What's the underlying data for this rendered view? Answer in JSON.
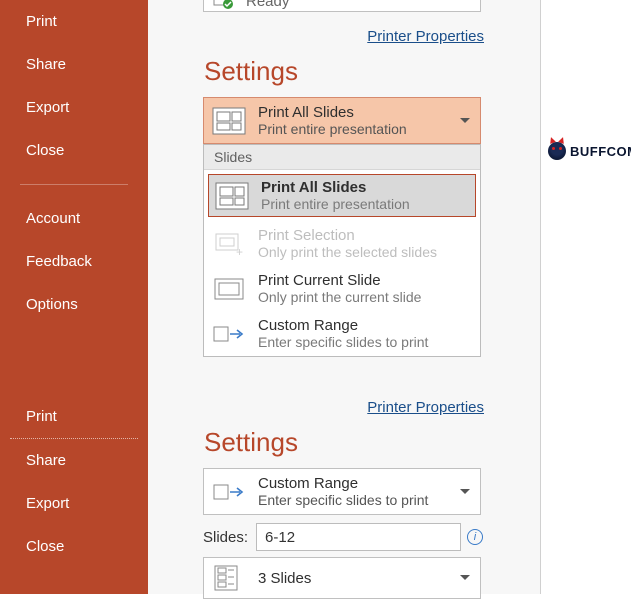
{
  "sidebar": {
    "items_top": [
      "Print",
      "Share",
      "Export",
      "Close"
    ],
    "items_mid": [
      "Account",
      "Feedback",
      "Options"
    ],
    "items_bot": [
      "Print",
      "Share",
      "Export",
      "Close"
    ]
  },
  "printer": {
    "status": "Ready",
    "link": "Printer Properties"
  },
  "settings": {
    "heading": "Settings",
    "slides_group_label": "Slides"
  },
  "dd_selected": {
    "title": "Print All Slides",
    "sub": "Print entire presentation"
  },
  "dd_options": [
    {
      "title": "Print All Slides",
      "sub": "Print entire presentation",
      "selected": true,
      "disabled": false,
      "icon": "slides-all-icon"
    },
    {
      "title": "Print Selection",
      "sub": "Only print the selected slides",
      "selected": false,
      "disabled": true,
      "icon": "slides-selection-icon"
    },
    {
      "title": "Print Current Slide",
      "sub": "Only print the current slide",
      "selected": false,
      "disabled": false,
      "icon": "slide-single-icon"
    },
    {
      "title": "Custom Range",
      "sub": "Enter specific slides to print",
      "selected": false,
      "disabled": false,
      "icon": "custom-range-icon"
    }
  ],
  "lower": {
    "link": "Printer Properties",
    "heading": "Settings",
    "range": {
      "title": "Custom Range",
      "sub": "Enter specific slides to print"
    },
    "slides_label": "Slides:",
    "slides_value": "6-12",
    "layout": {
      "title": "3 Slides"
    }
  },
  "watermark": {
    "text": "BUFFCOM"
  }
}
